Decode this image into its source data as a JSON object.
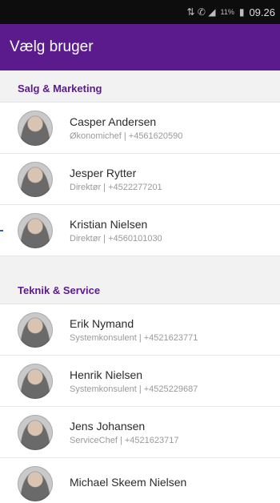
{
  "status_bar": {
    "signal_icons": "⇅ ✆ ◢",
    "battery": "11%",
    "time": "09.26"
  },
  "app_bar": {
    "title": "Vælg bruger"
  },
  "sections": [
    {
      "title": "Salg & Marketing",
      "users": [
        {
          "name": "Casper Andersen",
          "detail": "Økonomichef | +4561620590"
        },
        {
          "name": "Jesper Rytter",
          "detail": "Direktør | +4522277201"
        },
        {
          "name": "Kristian Nielsen",
          "detail": "Direktør | +4560101030"
        }
      ]
    },
    {
      "title": "Teknik & Service",
      "users": [
        {
          "name": "Erik Nymand",
          "detail": "Systemkonsulent | +4521623771"
        },
        {
          "name": "Henrik Nielsen",
          "detail": "Systemkonsulent | +4525229687"
        },
        {
          "name": "Jens Johansen",
          "detail": "ServiceChef | +4521623717"
        },
        {
          "name": "Michael Skeem Nielsen",
          "detail": ""
        }
      ]
    }
  ]
}
